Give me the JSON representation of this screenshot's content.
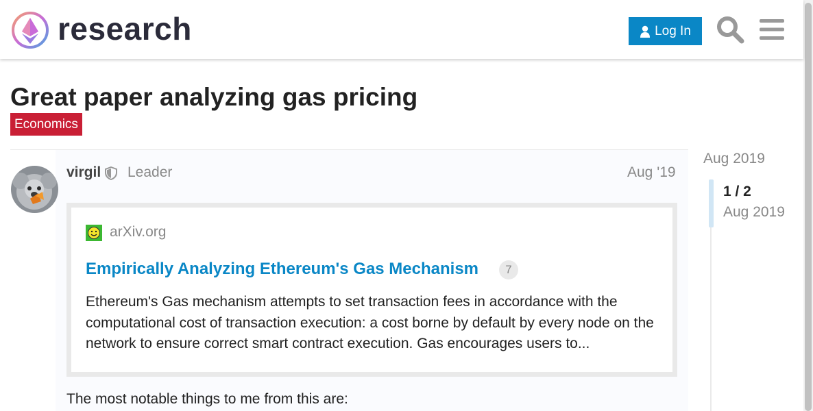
{
  "header": {
    "logo_text": "research",
    "login_label": "Log In"
  },
  "topic": {
    "title": "Great paper analyzing gas pricing",
    "category": "Economics",
    "category_color": "#c91f35"
  },
  "post": {
    "username": "virgil",
    "user_title": "Leader",
    "date": "Aug '19",
    "onebox": {
      "source": "arXiv.org",
      "title": "Empirically Analyzing Ethereum's Gas Mechanism",
      "click_count": "7",
      "description": "Ethereum's Gas mechanism attempts to set transaction fees in accordance with the computational cost of transaction execution: a cost borne by default by every node on the network to ensure correct smart contract execution. Gas encourages users to..."
    },
    "body_text": "The most notable things to me from this are:"
  },
  "timeline": {
    "top_date": "Aug 2019",
    "position": "1 / 2",
    "current_date": "Aug 2019"
  },
  "colors": {
    "accent": "#0a87c6",
    "category": "#c91f35"
  },
  "icons": [
    "logo-icon",
    "user-icon",
    "search-icon",
    "menu-icon",
    "shield-icon",
    "arxiv-favicon-icon"
  ]
}
